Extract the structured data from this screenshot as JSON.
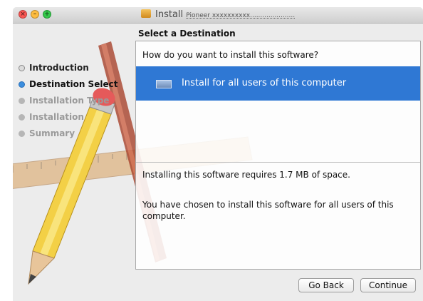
{
  "window": {
    "title_prefix": "Install",
    "title_suffix": "Pioneer xxxxxxxxxx......................"
  },
  "heading": "Select a Destination",
  "steps": [
    {
      "label": "Introduction",
      "state": "done"
    },
    {
      "label": "Destination Select",
      "state": "current"
    },
    {
      "label": "Installation Type",
      "state": "todo"
    },
    {
      "label": "Installation",
      "state": "todo"
    },
    {
      "label": "Summary",
      "state": "todo"
    }
  ],
  "panel": {
    "question": "How do you want to install this software?",
    "option_label": "Install for all users of this computer",
    "space_text": "Installing this software requires 1.7 MB of space.",
    "choice_text": "You have chosen to install this software for all users of this computer."
  },
  "buttons": {
    "back": "Go Back",
    "continue": "Continue"
  },
  "colors": {
    "selection": "#2f78d4",
    "current_step_bullet": "#3b8ede"
  }
}
